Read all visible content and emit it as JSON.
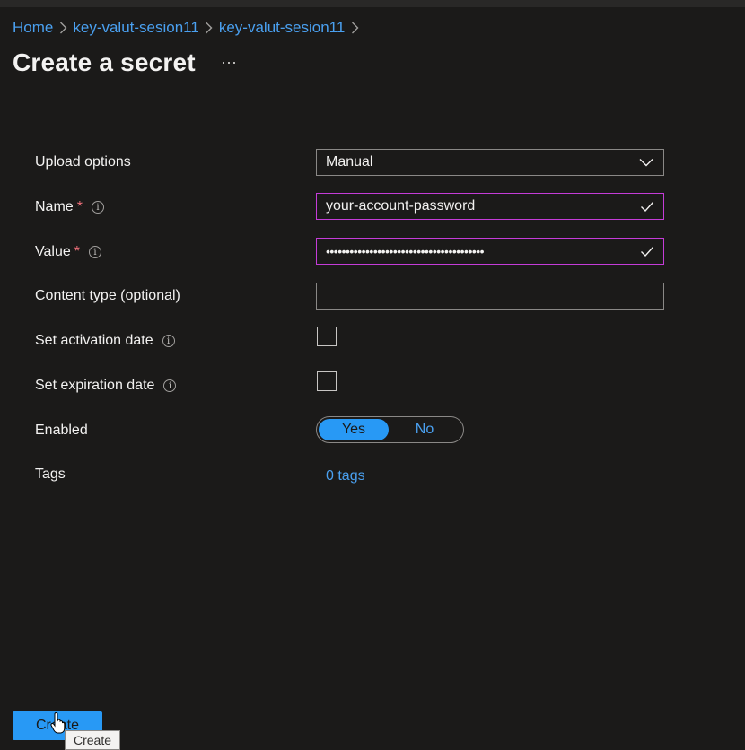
{
  "breadcrumb": {
    "items": [
      "Home",
      "key-valut-sesion11",
      "key-valut-sesion11"
    ]
  },
  "page": {
    "title": "Create a secret",
    "more_glyph": "···"
  },
  "form": {
    "upload_options": {
      "label": "Upload options",
      "value": "Manual"
    },
    "name": {
      "label": "Name",
      "required_mark": "*",
      "value": "your-account-password"
    },
    "value": {
      "label": "Value",
      "required_mark": "*",
      "masked_value": "••••••••••••••••••••••••••••••••••••••••"
    },
    "content_type": {
      "label": "Content type (optional)",
      "value": ""
    },
    "activation": {
      "label": "Set activation date",
      "checked": false
    },
    "expiration": {
      "label": "Set expiration date",
      "checked": false
    },
    "enabled": {
      "label": "Enabled",
      "options": [
        "Yes",
        "No"
      ],
      "selected": "Yes"
    },
    "tags": {
      "label": "Tags",
      "link_text": "0 tags"
    }
  },
  "footer": {
    "create_label": "Create",
    "tooltip": "Create"
  },
  "icons": {
    "info": "info-icon",
    "check": "checkmark-icon",
    "dropdown": "chevron-down-icon",
    "breadcrumb_sep": "chevron-right-icon"
  },
  "colors": {
    "background": "#1b1a19",
    "accent": "#2899f5",
    "link": "#4aa0f0",
    "focus_border": "#c43cd8",
    "required": "#f1707b"
  }
}
